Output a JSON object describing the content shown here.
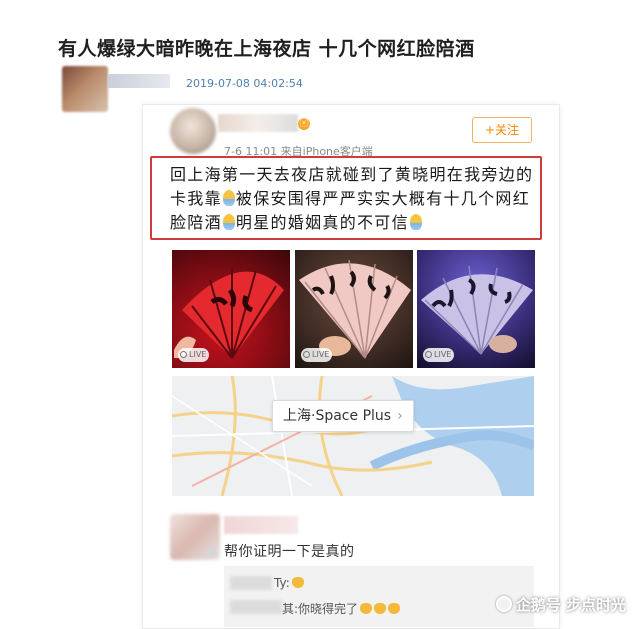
{
  "article": {
    "title": "有人爆绿大暗昨晚在上海夜店 十几个网红脸陪酒",
    "timestamp": "2019-07-08 04:02:54"
  },
  "weibo_post": {
    "vip_badge": "ⓥ",
    "meta": "7-6 11:01  来自iPhone客户端",
    "follow_label": "+关注",
    "text_segments": [
      "回上海第一天去夜店就碰到了黄晓明在我旁边的卡我靠",
      "被保安围得严严实实大概有十几个网红脸陪酒",
      "明星的婚姻真的不可信"
    ],
    "photos": [
      {
        "live_label": "LIVE"
      },
      {
        "live_label": "LIVE"
      },
      {
        "live_label": "LIVE"
      }
    ],
    "location": {
      "label": "上海·Space Plus",
      "chevron": "›"
    }
  },
  "comment": {
    "text": "帮你证明一下是真的",
    "replies": [
      {
        "name_suffix": "Ty:",
        "text": ""
      },
      {
        "name_suffix": "其:",
        "text": "你晓得完了"
      }
    ]
  },
  "watermark": {
    "text": "企鹅号 步点时光"
  },
  "colors": {
    "highlight_border": "#cf3b3b",
    "follow_orange": "#ff8200",
    "timestamp_blue": "#4f7fb3"
  }
}
